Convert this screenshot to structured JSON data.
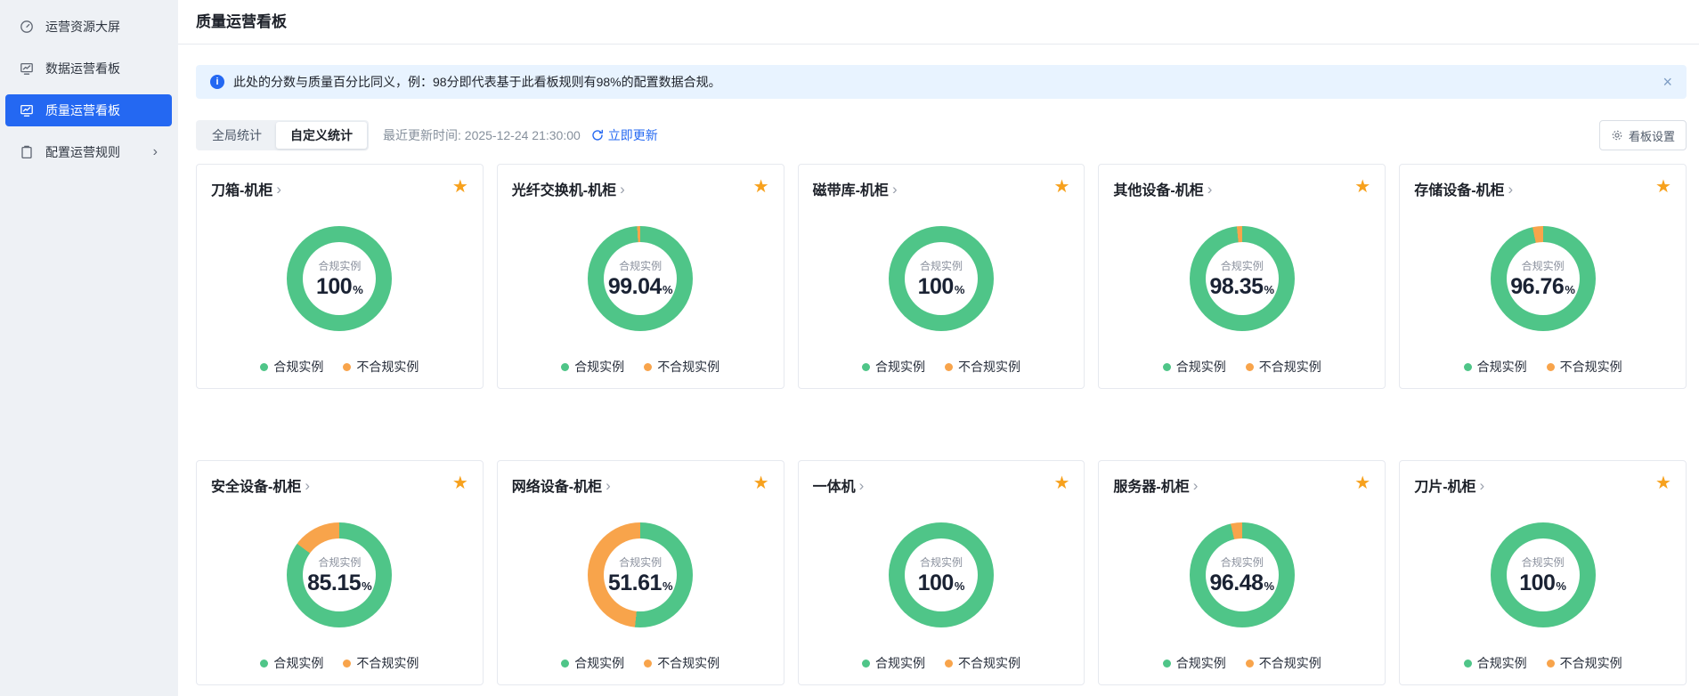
{
  "colors": {
    "green": "#4FC588",
    "orange": "#F8A44B",
    "accent_blue": "#2468F2",
    "star": "#F7A11D"
  },
  "icons": {
    "close": "×",
    "star": "★",
    "chevron_right": "›",
    "info": "i"
  },
  "sidebar": {
    "items": [
      {
        "label": "运营资源大屏",
        "icon": "gauge-icon",
        "active": false
      },
      {
        "label": "数据运营看板",
        "icon": "monitor-chart-icon",
        "active": false
      },
      {
        "label": "质量运营看板",
        "icon": "monitor-chart-icon",
        "active": true
      },
      {
        "label": "配置运营规则",
        "icon": "clipboard-icon",
        "active": false,
        "has_children": true
      }
    ]
  },
  "header": {
    "title": "质量运营看板"
  },
  "banner": {
    "text": "此处的分数与质量百分比同义，例：98分即代表基于此看板规则有98%的配置数据合规。"
  },
  "toolbar": {
    "tabs": [
      {
        "label": "全局统计",
        "active": false
      },
      {
        "label": "自定义统计",
        "active": true
      }
    ],
    "updated_label": "最近更新时间: 2025-12-24 21:30:00",
    "refresh_label": "立即更新",
    "settings_label": "看板设置"
  },
  "labels": {
    "center_label": "合规实例",
    "percent_suffix": "%"
  },
  "legend": {
    "compliant": "合规实例",
    "noncompliant": "不合规实例"
  },
  "cards": [
    {
      "title": "刀箱-机柜",
      "value_display": "100",
      "percent": 100
    },
    {
      "title": "光纤交换机-机柜",
      "value_display": "99.04",
      "percent": 99.04
    },
    {
      "title": "磁带库-机柜",
      "value_display": "100",
      "percent": 100
    },
    {
      "title": "其他设备-机柜",
      "value_display": "98.35",
      "percent": 98.35
    },
    {
      "title": "存储设备-机柜",
      "value_display": "96.76",
      "percent": 96.76
    },
    {
      "title": "安全设备-机柜",
      "value_display": "85.15",
      "percent": 85.15
    },
    {
      "title": "网络设备-机柜",
      "value_display": "51.61",
      "percent": 51.61
    },
    {
      "title": "一体机",
      "value_display": "100",
      "percent": 100
    },
    {
      "title": "服务器-机柜",
      "value_display": "96.48",
      "percent": 96.48
    },
    {
      "title": "刀片-机柜",
      "value_display": "100",
      "percent": 100
    }
  ],
  "chart_data": {
    "type": "pie",
    "legend_entries": [
      "合规实例",
      "不合规实例"
    ],
    "series_colors": {
      "合规实例": "#4FC588",
      "不合规实例": "#F8A44B"
    },
    "charts": [
      {
        "title": "刀箱-机柜",
        "compliant_pct": 100,
        "noncompliant_pct": 0
      },
      {
        "title": "光纤交换机-机柜",
        "compliant_pct": 99.04,
        "noncompliant_pct": 0.96
      },
      {
        "title": "磁带库-机柜",
        "compliant_pct": 100,
        "noncompliant_pct": 0
      },
      {
        "title": "其他设备-机柜",
        "compliant_pct": 98.35,
        "noncompliant_pct": 1.65
      },
      {
        "title": "存储设备-机柜",
        "compliant_pct": 96.76,
        "noncompliant_pct": 3.24
      },
      {
        "title": "安全设备-机柜",
        "compliant_pct": 85.15,
        "noncompliant_pct": 14.85
      },
      {
        "title": "网络设备-机柜",
        "compliant_pct": 51.61,
        "noncompliant_pct": 48.39
      },
      {
        "title": "一体机",
        "compliant_pct": 100,
        "noncompliant_pct": 0
      },
      {
        "title": "服务器-机柜",
        "compliant_pct": 96.48,
        "noncompliant_pct": 3.52
      },
      {
        "title": "刀片-机柜",
        "compliant_pct": 100,
        "noncompliant_pct": 0
      }
    ]
  }
}
